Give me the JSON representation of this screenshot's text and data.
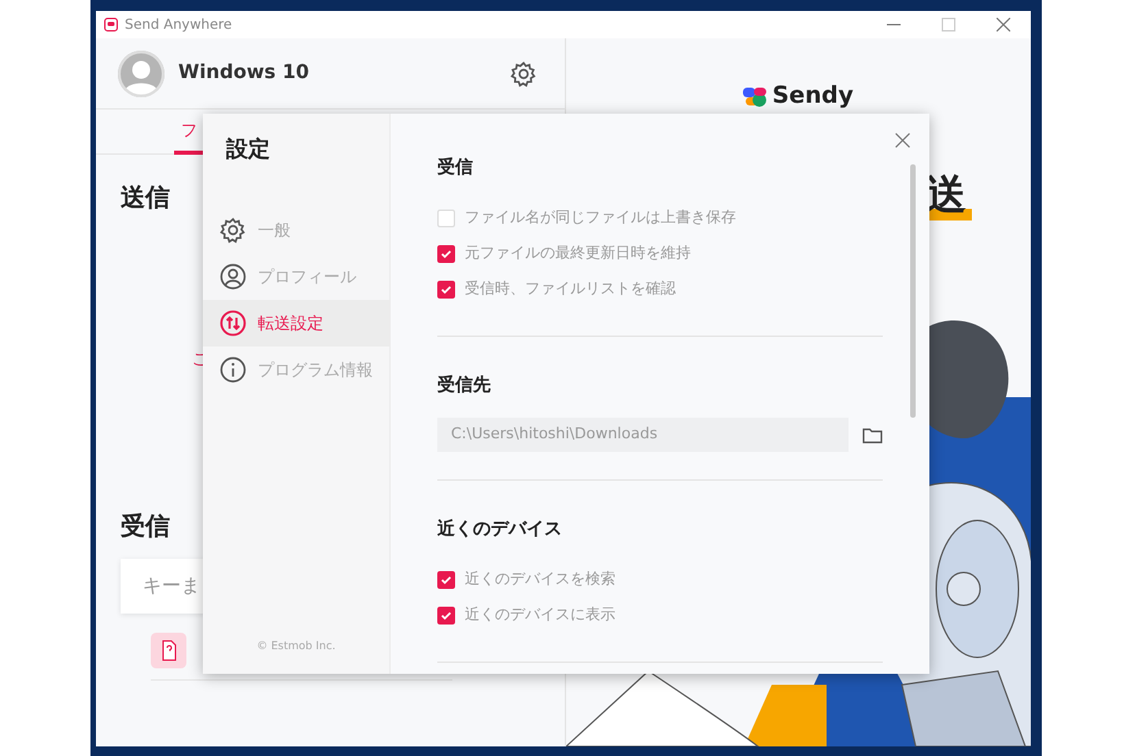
{
  "window": {
    "title": "Send Anywhere"
  },
  "profile": {
    "name": "Windows 10"
  },
  "tabs": [
    {
      "label": "フ",
      "selected": true
    }
  ],
  "send": {
    "title": "送信",
    "hint": "こ"
  },
  "receive": {
    "title": "受信",
    "key_field": {
      "placeholder": "キーま"
    }
  },
  "promo": {
    "logo": "Sendy",
    "headline": "送"
  },
  "settings": {
    "title": "設定",
    "nav": [
      {
        "label": "一般",
        "kind": "gear",
        "selected": false
      },
      {
        "label": "プロフィール",
        "kind": "person",
        "selected": false
      },
      {
        "label": "転送設定",
        "kind": "transfer",
        "selected": true
      },
      {
        "label": "プログラム情報",
        "kind": "info",
        "selected": false
      }
    ],
    "footer": "© Estmob Inc.",
    "sections": [
      {
        "title": "受信",
        "kind": "checks",
        "options": [
          {
            "label": "ファイル名が同じファイルは上書き保存",
            "checked": false
          },
          {
            "label": "元ファイルの最終更新日時を維持",
            "checked": true
          },
          {
            "label": "受信時、ファイルリストを確認",
            "checked": true
          }
        ]
      },
      {
        "title": "受信先",
        "kind": "path",
        "value": "C:\\Users\\hitoshi\\Downloads"
      },
      {
        "title": "近くのデバイス",
        "kind": "checks",
        "options": [
          {
            "label": "近くのデバイスを検索",
            "checked": true
          },
          {
            "label": "近くのデバイスに表示",
            "checked": true
          }
        ]
      }
    ]
  }
}
